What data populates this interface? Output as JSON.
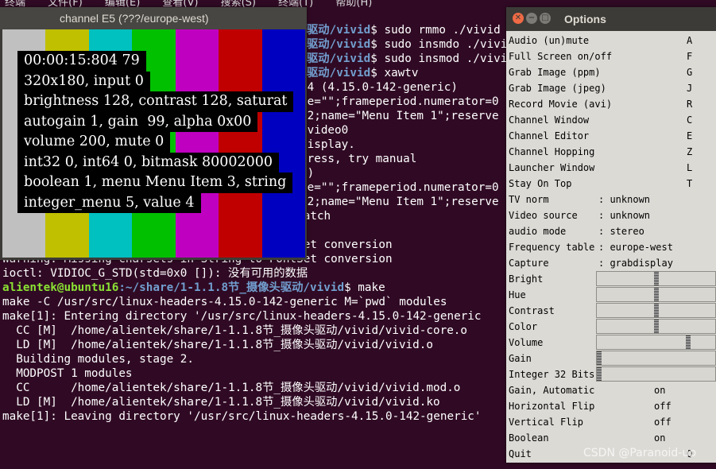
{
  "terminal": {
    "menubar": [
      "终端",
      "文件(F)",
      "编辑(E)",
      "查看(V)",
      "搜索(S)",
      "终端(T)",
      "帮助(H)"
    ],
    "lines": [
      {
        "prompt_path": "驱动/vivid",
        "cmd": "$ sudo rmmo ./vivid"
      },
      {
        "prompt_path": "驱动/vivid",
        "cmd": "$ sudo insmdo ./vivi"
      },
      {
        "prompt_path": "驱动/vivid",
        "cmd": "$ sudo insmod ./vivi"
      },
      {
        "prompt_path": "驱动/vivid",
        "cmd": "$ xawtv"
      },
      {
        "text": "64 (4.15.0-142-generic)"
      },
      {
        "text": "me=\"\";frameperiod.numerator=0"
      },
      {
        "text": "=2;name=\"Menu Item 1\";reserve"
      },
      {
        "text": "/video0"
      },
      {
        "text": "display."
      },
      {
        "text": "dress, try manual"
      },
      {
        "text": "\")"
      },
      {
        "text": "me=\"\";frameperiod.numerator=0"
      },
      {
        "text": "=2;name=\"Menu Item 1\";reserve"
      },
      {
        "text": "v4l2: WARNING: framebuffer base address mismatch"
      },
      {
        "text": "v4l2: me=(nil) v4l=(nil)"
      },
      {
        "text": "Warning: Missing charsets in String to FontSet conversion"
      },
      {
        "text": "Warning: Missing charsets in String to FontSet conversion"
      },
      {
        "text": "ioctl: VIDIOC_G_STD(std=0x0 []): 没有可用的数据"
      },
      {
        "user": "alientek@ubuntu16",
        "path": ":~/share/1-1.1.8节_摄像头驱动/vivid",
        "cmd": "$ make"
      },
      {
        "text": "make -C /usr/src/linux-headers-4.15.0-142-generic M=`pwd` modules"
      },
      {
        "text": "make[1]: Entering directory '/usr/src/linux-headers-4.15.0-142-generic"
      },
      {
        "text": "  CC [M]  /home/alientek/share/1-1.1.8节_摄像头驱动/vivid/vivid-core.o"
      },
      {
        "text": "  LD [M]  /home/alientek/share/1-1.1.8节_摄像头驱动/vivid/vivid.o"
      },
      {
        "text": "  Building modules, stage 2."
      },
      {
        "text": "  MODPOST 1 modules"
      },
      {
        "text": "  CC      /home/alientek/share/1-1.1.8节_摄像头驱动/vivid/vivid.mod.o"
      },
      {
        "text": "  LD [M]  /home/alientek/share/1-1.1.8节_摄像头驱动/vivid/vivid.ko"
      },
      {
        "text": "make[1]: Leaving directory '/usr/src/linux-headers-4.15.0-142-generic'"
      }
    ]
  },
  "channel_window": {
    "title": "channel E5 (???/europe-west)",
    "color_bars": [
      "#c0c0c0",
      "#c0c000",
      "#00c0c0",
      "#00c000",
      "#c000c0",
      "#c00000",
      "#0000c0"
    ],
    "osd": [
      "00:00:15:804 79",
      "320x180, input 0",
      "brightness 128, contrast 128, saturat",
      "autogain 1, gain  99, alpha 0x00",
      "volume 200, mute 0",
      "int32 0, int64 0, bitmask 80002000",
      "boolean 1, menu Menu Item 3, string",
      "integer_menu 5, value 4"
    ]
  },
  "options_window": {
    "title": "Options",
    "menu_items": [
      {
        "label": "Audio (un)mute",
        "key": "A"
      },
      {
        "label": "Full Screen on/off",
        "key": "F"
      },
      {
        "label": "Grab Image (ppm)",
        "key": "G"
      },
      {
        "label": "Grab Image (jpeg)",
        "key": "J"
      },
      {
        "label": "Record Movie (avi)",
        "key": "R"
      },
      {
        "label": "Channel Window",
        "key": "C"
      },
      {
        "label": "Channel Editor",
        "key": "E"
      },
      {
        "label": "Channel Hopping",
        "key": "Z"
      },
      {
        "label": "Launcher Window",
        "key": "L"
      },
      {
        "label": "Stay On Top",
        "key": "T"
      }
    ],
    "settings": [
      {
        "label": "TV norm",
        "value": ": unknown"
      },
      {
        "label": "Video source",
        "value": ": unknown"
      },
      {
        "label": "audio mode",
        "value": ": stereo"
      },
      {
        "label": "Frequency table",
        "value": ": europe-west"
      },
      {
        "label": "Capture",
        "value": ": grabdisplay"
      }
    ],
    "sliders": [
      {
        "label": "Bright",
        "level": 0.5
      },
      {
        "label": "Hue",
        "level": 0.5
      },
      {
        "label": "Contrast",
        "level": 0.5
      },
      {
        "label": "Color",
        "level": 0.5
      },
      {
        "label": "Volume",
        "level": 0.78
      },
      {
        "label": "Gain",
        "level": 0.0
      },
      {
        "label": "Integer 32 Bits",
        "level": 0.0
      }
    ],
    "toggles": [
      {
        "label": "Gain, Automatic",
        "value": "on"
      },
      {
        "label": "Horizontal Flip",
        "value": "off"
      },
      {
        "label": "Vertical Flip",
        "value": "off"
      },
      {
        "label": "Boolean",
        "value": "on"
      }
    ],
    "quit": {
      "label": "Quit",
      "key": "Q"
    }
  },
  "watermark": "CSDN @Paranoid-up"
}
